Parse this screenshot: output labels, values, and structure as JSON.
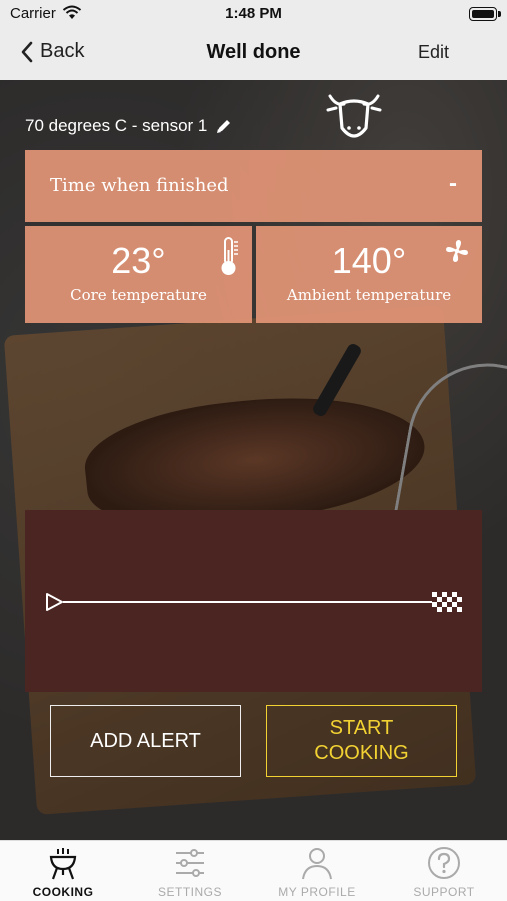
{
  "status_bar": {
    "carrier": "Carrier",
    "time": "1:48 PM"
  },
  "nav": {
    "back_label": "Back",
    "title": "Well done",
    "edit_label": "Edit"
  },
  "sensor": {
    "label": "70 degrees C - sensor 1"
  },
  "finished": {
    "label": "Time when finished",
    "value": "-"
  },
  "core": {
    "value": "23°",
    "label": "Core temperature"
  },
  "ambient": {
    "value": "140°",
    "label": "Ambient temperature"
  },
  "buttons": {
    "add_alert": "ADD ALERT",
    "start_cooking_line1": "START",
    "start_cooking_line2": "COOKING"
  },
  "tabs": [
    {
      "label": "COOKING",
      "icon": "grill-icon",
      "active": true
    },
    {
      "label": "SETTINGS",
      "icon": "sliders-icon",
      "active": false
    },
    {
      "label": "MY PROFILE",
      "icon": "user-icon",
      "active": false
    },
    {
      "label": "SUPPORT",
      "icon": "help-icon",
      "active": false
    }
  ],
  "colors": {
    "accent_tile": "#e29476",
    "panel": "#4a2521",
    "start_button": "#f2d233"
  }
}
